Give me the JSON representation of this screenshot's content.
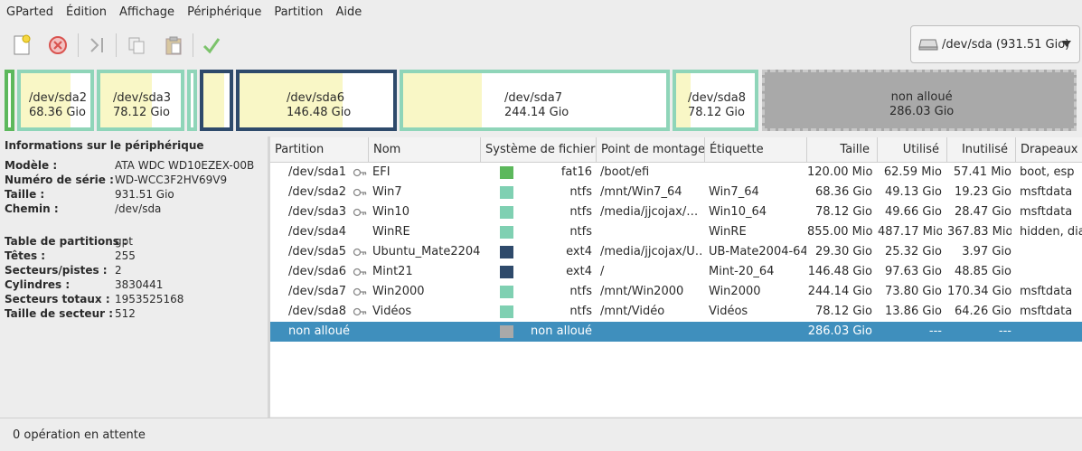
{
  "menu": [
    "GParted",
    "Édition",
    "Affichage",
    "Périphérique",
    "Partition",
    "Aide"
  ],
  "toolbar": {
    "icons": [
      "new-partition-icon",
      "delete-icon",
      "resize-move-icon",
      "copy-icon",
      "paste-icon",
      "apply-icon"
    ]
  },
  "device": {
    "label": "/dev/sda (931.51 Gio)",
    "icon": "harddisk-icon"
  },
  "map": {
    "sda2": {
      "name": "/dev/sda2",
      "size": "68.36 Gio",
      "used_fraction": 0.72
    },
    "sda3": {
      "name": "/dev/sda3",
      "size": "78.12 Gio",
      "used_fraction": 0.64
    },
    "sda6": {
      "name": "/dev/sda6",
      "size": "146.48 Gio",
      "used_fraction": 0.67
    },
    "sda7": {
      "name": "/dev/sda7",
      "size": "244.14 Gio",
      "used_fraction": 0.3
    },
    "sda8": {
      "name": "/dev/sda8",
      "size": "78.12 Gio",
      "used_fraction": 0.18
    },
    "unalloc": {
      "name": "non alloué",
      "size": "286.03 Gio"
    }
  },
  "info": {
    "title": "Informations sur le périphérique",
    "rows1": [
      {
        "k": "Modèle :",
        "v": "ATA WDC WD10EZEX-00B"
      },
      {
        "k": "Numéro de série :",
        "v": "WD-WCC3F2HV69V9"
      },
      {
        "k": "Taille :",
        "v": "931.51 Gio"
      },
      {
        "k": "Chemin :",
        "v": "/dev/sda"
      }
    ],
    "rows2": [
      {
        "k": "Table de partitions :",
        "v": "gpt"
      },
      {
        "k": "Têtes :",
        "v": "255"
      },
      {
        "k": "Secteurs/pistes :",
        "v": "2"
      },
      {
        "k": "Cylindres :",
        "v": "3830441"
      },
      {
        "k": "Secteurs totaux :",
        "v": "1953525168"
      },
      {
        "k": "Taille de secteur :",
        "v": "512"
      }
    ]
  },
  "table": {
    "headers": [
      "Partition",
      "Nom",
      "Système de fichiers",
      "Point de montage",
      "Étiquette",
      "Taille",
      "Utilisé",
      "Inutilisé",
      "Drapeaux"
    ],
    "rows": [
      {
        "partition": "/dev/sda1",
        "key": true,
        "nom": "EFI",
        "fs": "fat16",
        "color": "#5cb85c",
        "mount": "/boot/efi",
        "label": "",
        "size": "120.00 Mio",
        "used": "62.59 Mio",
        "unused": "57.41 Mio",
        "flags": "boot, esp"
      },
      {
        "partition": "/dev/sda2",
        "key": true,
        "nom": "Win7",
        "fs": "ntfs",
        "color": "#7fd0b2",
        "mount": "/mnt/Win7_64",
        "label": "Win7_64",
        "size": "68.36 Gio",
        "used": "49.13 Gio",
        "unused": "19.23 Gio",
        "flags": "msftdata"
      },
      {
        "partition": "/dev/sda3",
        "key": true,
        "nom": "Win10",
        "fs": "ntfs",
        "color": "#7fd0b2",
        "mount": "/media/jjcojax/…",
        "label": "Win10_64",
        "size": "78.12 Gio",
        "used": "49.66 Gio",
        "unused": "28.47 Gio",
        "flags": "msftdata"
      },
      {
        "partition": "/dev/sda4",
        "key": false,
        "nom": "WinRE",
        "fs": "ntfs",
        "color": "#7fd0b2",
        "mount": "",
        "label": "WinRE",
        "size": "855.00 Mio",
        "used": "487.17 Mio",
        "unused": "367.83 Mio",
        "flags": "hidden, diag"
      },
      {
        "partition": "/dev/sda5",
        "key": true,
        "nom": "Ubuntu_Mate2204",
        "fs": "ext4",
        "color": "#2e4a6b",
        "mount": "/media/jjcojax/U…",
        "label": "UB-Mate2004-64",
        "size": "29.30 Gio",
        "used": "25.32 Gio",
        "unused": "3.97 Gio",
        "flags": ""
      },
      {
        "partition": "/dev/sda6",
        "key": true,
        "nom": "Mint21",
        "fs": "ext4",
        "color": "#2e4a6b",
        "mount": "/",
        "label": "Mint-20_64",
        "size": "146.48 Gio",
        "used": "97.63 Gio",
        "unused": "48.85 Gio",
        "flags": ""
      },
      {
        "partition": "/dev/sda7",
        "key": true,
        "nom": "Win2000",
        "fs": "ntfs",
        "color": "#7fd0b2",
        "mount": "/mnt/Win2000",
        "label": "Win2000",
        "size": "244.14 Gio",
        "used": "73.80 Gio",
        "unused": "170.34 Gio",
        "flags": "msftdata"
      },
      {
        "partition": "/dev/sda8",
        "key": true,
        "nom": "Vidéos",
        "fs": "ntfs",
        "color": "#7fd0b2",
        "mount": "/mnt/Vidéo",
        "label": "Vidéos",
        "size": "78.12 Gio",
        "used": "13.86 Gio",
        "unused": "64.26 Gio",
        "flags": "msftdata"
      },
      {
        "partition": "non alloué",
        "key": false,
        "nom": "",
        "fs": "non alloué",
        "color": "#a9a9a9",
        "mount": "",
        "label": "",
        "size": "286.03 Gio",
        "used": "---",
        "unused": "---",
        "flags": "",
        "selected": true
      }
    ]
  },
  "status": "0 opération en attente"
}
